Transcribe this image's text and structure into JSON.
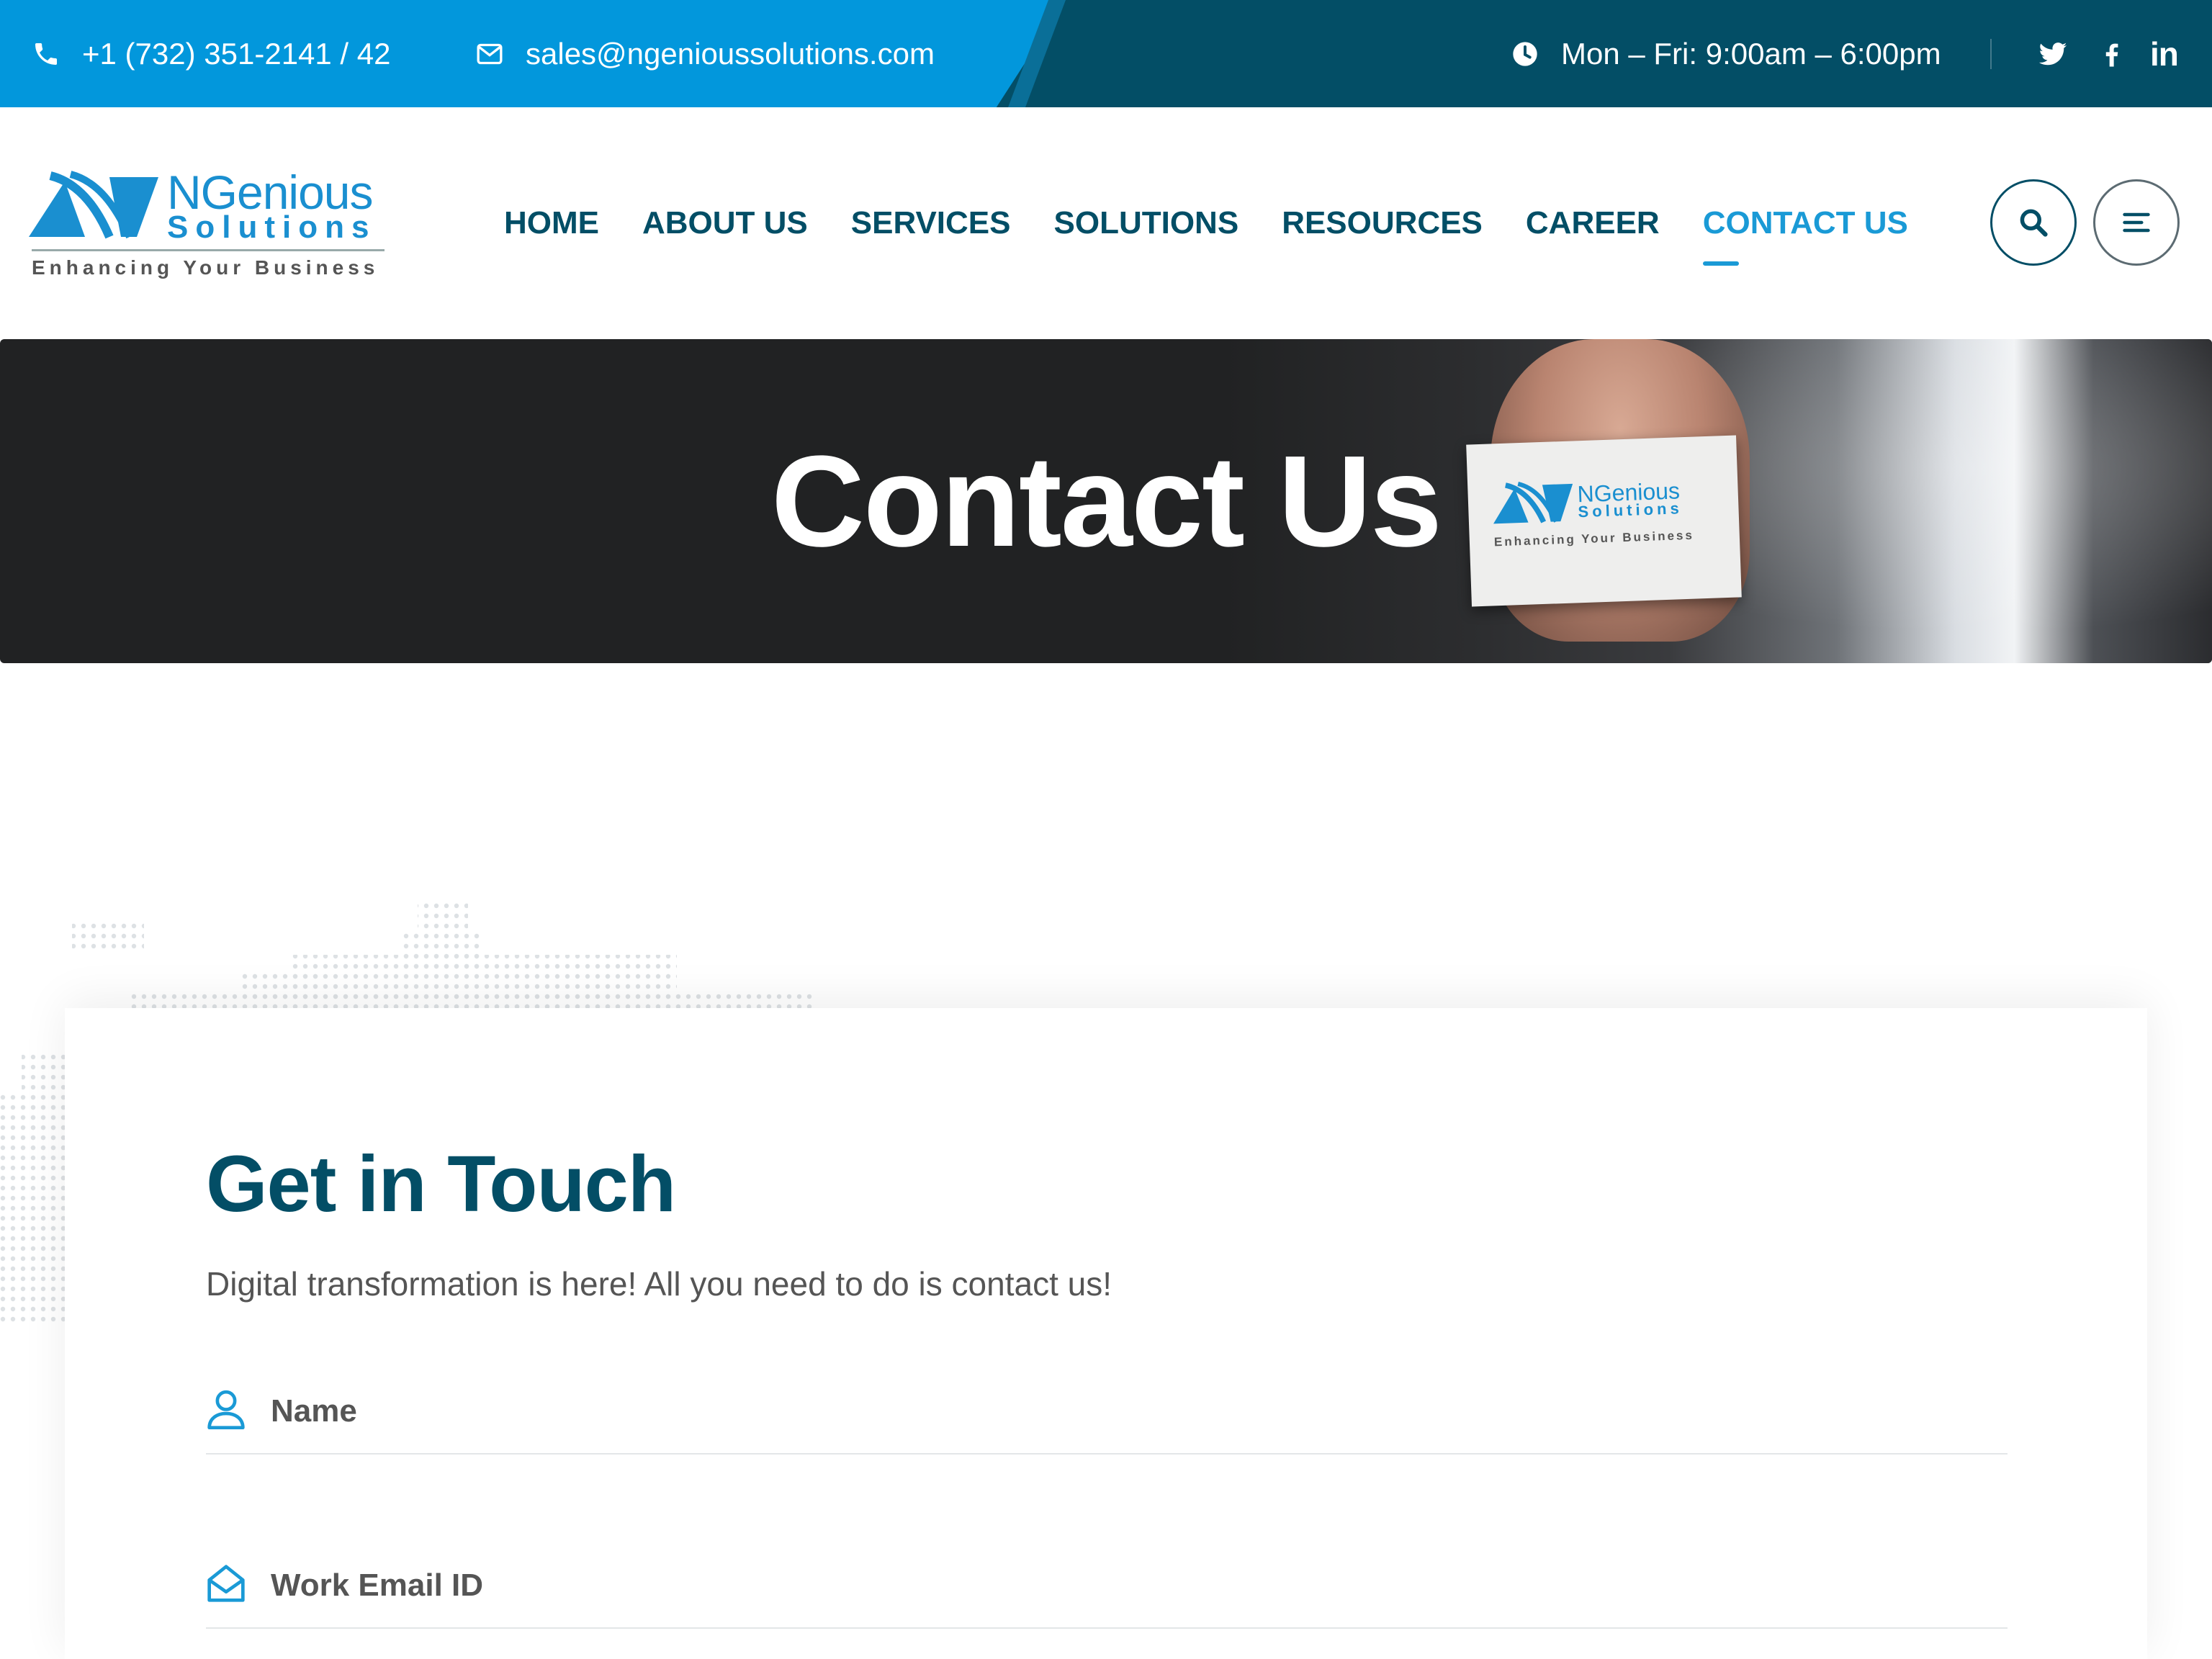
{
  "topbar": {
    "phone": "+1 (732) 351-2141 / 42",
    "email": "sales@ngenioussolutions.com",
    "hours": "Mon – Fri: 9:00am – 6:00pm",
    "social": [
      "twitter-icon",
      "facebook-icon",
      "linkedin-icon"
    ],
    "linkedin_glyph": "in"
  },
  "brand": {
    "name": "NGenious",
    "sub": "Solutions",
    "tagline": "Enhancing Your Business"
  },
  "nav": {
    "items": [
      "HOME",
      "ABOUT US",
      "SERVICES",
      "SOLUTIONS",
      "RESOURCES",
      "CAREER",
      "CONTACT US"
    ],
    "active": "CONTACT US"
  },
  "banner": {
    "title": "Contact Us"
  },
  "form": {
    "title": "Get in Touch",
    "subtitle": "Digital transformation is here! All you need to do is contact us!",
    "fields": [
      {
        "label": "Name",
        "icon": "user-icon"
      },
      {
        "label": "Work Email ID",
        "icon": "envelope-icon"
      }
    ]
  },
  "colors": {
    "primary_dark": "#034e66",
    "accent_blue": "#0297dc",
    "active_nav": "#1a9ad6",
    "banner_bg": "#212223"
  }
}
